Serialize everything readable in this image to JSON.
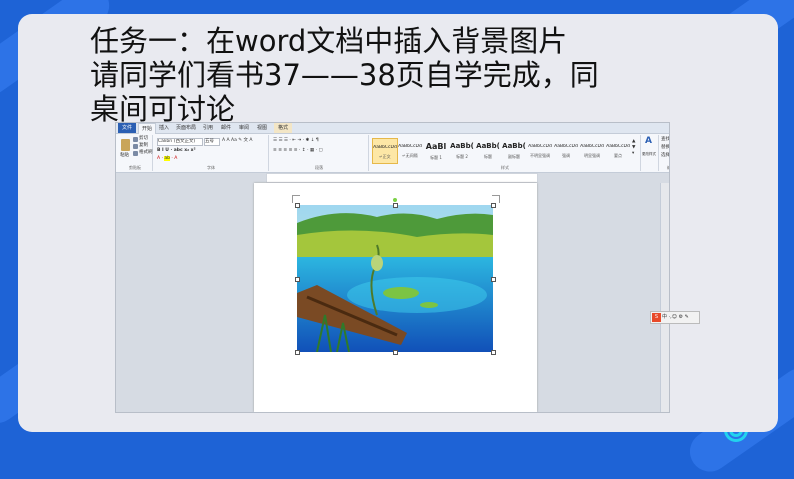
{
  "slide": {
    "title_line1": "任务一：在word文档中插入背景图片",
    "title_line2": "请同学们看书37——38页自学完成，同",
    "title_line3": "桌间可讨论"
  },
  "word": {
    "tabs": [
      "文件",
      "开始",
      "插入",
      "页面布局",
      "引用",
      "邮件",
      "审阅",
      "视图",
      "格式"
    ],
    "ribbon": {
      "clipboard": {
        "paste": "粘贴",
        "cut": "剪切",
        "copy": "复制",
        "format_painter": "格式刷",
        "label": "剪贴板"
      },
      "font": {
        "font_name": "Calibri (西文正文)",
        "font_size": "五号",
        "label": "字体"
      },
      "paragraph": {
        "label": "段落"
      },
      "styles": {
        "label": "样式",
        "items": [
          {
            "sample": "AaBbCcDd",
            "name": "↵正文"
          },
          {
            "sample": "AaBbCcDd",
            "name": "↵无间隔"
          },
          {
            "sample": "AaBl",
            "name": "标题 1"
          },
          {
            "sample": "AaBb(",
            "name": "标题 2"
          },
          {
            "sample": "AaBb(",
            "name": "标题"
          },
          {
            "sample": "AaBb(",
            "name": "副标题"
          },
          {
            "sample": "AaBbCcDd",
            "name": "不明显强调"
          },
          {
            "sample": "AaBbCcDd",
            "name": "强调"
          },
          {
            "sample": "AaBbCcDd",
            "name": "明显强调"
          },
          {
            "sample": "AaBbCcDd",
            "name": "要点"
          }
        ]
      },
      "change_styles": "更改样式",
      "editing": {
        "find": "查找",
        "replace": "替换",
        "select": "选择",
        "label": "编辑"
      }
    },
    "ime_toolbar": "中 ·,☺ ⚙ ✎"
  },
  "colors": {
    "background": "#1e63d6",
    "card": "#e9eaf0",
    "accent": "#22d3ee",
    "file_tab": "#2b5fb3"
  }
}
